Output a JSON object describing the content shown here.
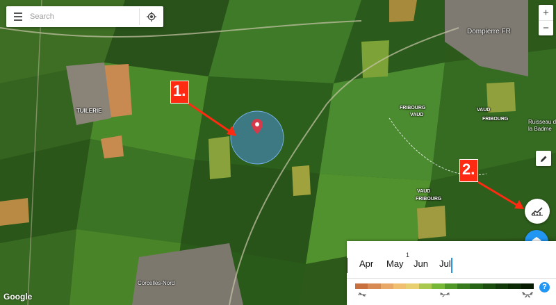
{
  "search": {
    "placeholder": "Search"
  },
  "annotations": {
    "step1": "1.",
    "step2": "2."
  },
  "places": {
    "tuilerie": "TUILERIE",
    "dompierre": "Dompierre FR",
    "corcelles": "Corcelles-Nord",
    "ruisseau": "Ruisseau de",
    "badme": "la Badme",
    "fribourg": "FRIBOURG",
    "vaud": "VAUD",
    "fribourg2": "FRIBOURG",
    "vaud2": "VAUD",
    "fribourg3": "FRIBOURG",
    "vaud3": "VAUD"
  },
  "zoom": {
    "plus": "+",
    "minus": "−"
  },
  "timeline": {
    "months": [
      "Apr",
      "May",
      "Jun",
      "Jul"
    ],
    "cut_label": "Ju",
    "marker_label": "1"
  },
  "legend_colors": [
    "#c8703e",
    "#d88a55",
    "#e8a868",
    "#f0c070",
    "#e8d070",
    "#a8c850",
    "#78b838",
    "#509828",
    "#387a1e",
    "#286416",
    "#1c4e10",
    "#123a0a",
    "#0c2a06",
    "#081c04"
  ],
  "help": "?",
  "logo": "Google",
  "icons": {
    "menu": "menu-icon",
    "locate": "my-location-icon",
    "pin": "map-pin-icon",
    "draw": "pencil-icon",
    "chart": "chart-icon",
    "layers": "layers-icon"
  },
  "colors": {
    "accent": "#2196f3",
    "annotation": "#ff2a12",
    "pin": "#d63a4a"
  }
}
